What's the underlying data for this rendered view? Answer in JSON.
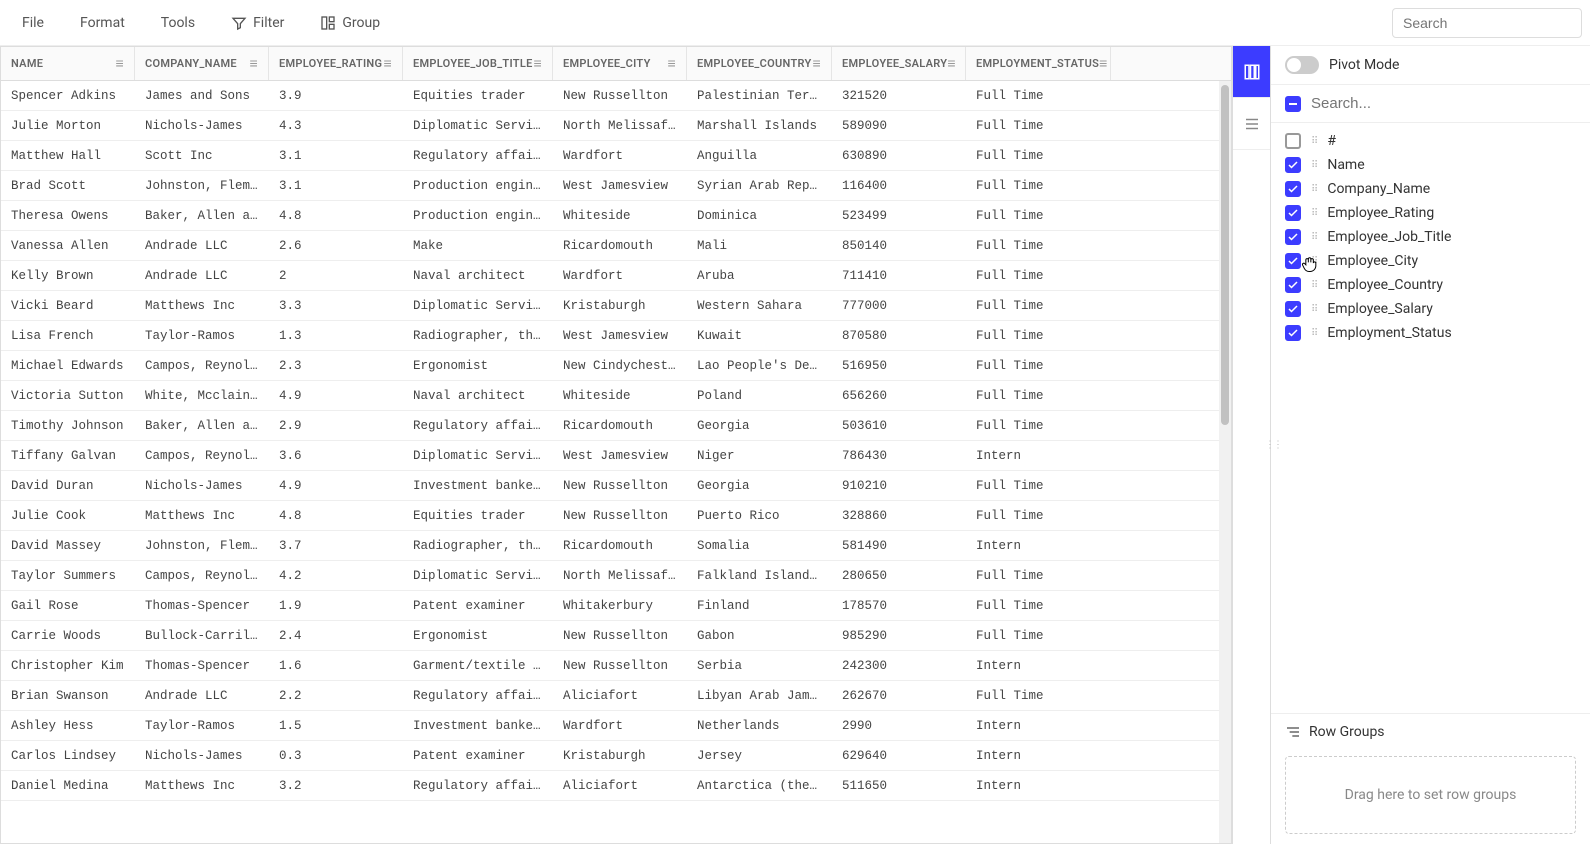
{
  "toolbar": {
    "file": "File",
    "format": "Format",
    "tools": "Tools",
    "filter": "Filter",
    "group": "Group",
    "search_placeholder": "Search"
  },
  "columns": [
    "NAME",
    "COMPANY_NAME",
    "EMPLOYEE_RATING",
    "EMPLOYEE_JOB_TITLE",
    "EMPLOYEE_CITY",
    "EMPLOYEE_COUNTRY",
    "EMPLOYEE_SALARY",
    "EMPLOYMENT_STATUS"
  ],
  "rows": [
    [
      "Spencer Adkins",
      "James and Sons",
      "3.9",
      "Equities trader",
      "New Russellton",
      "Palestinian Territory",
      "321520",
      "Full Time"
    ],
    [
      "Julie Morton",
      "Nichols-James",
      "4.3",
      "Diplomatic Services op",
      "North Melissafurt",
      "Marshall Islands",
      "589090",
      "Full Time"
    ],
    [
      "Matthew Hall",
      "Scott Inc",
      "3.1",
      "Regulatory affairs offi",
      "Wardfort",
      "Anguilla",
      "630890",
      "Full Time"
    ],
    [
      "Brad Scott",
      "Johnston, Fleming a",
      "3.1",
      "Production engineer",
      "West Jamesview",
      "Syrian Arab Republic",
      "116400",
      "Full Time"
    ],
    [
      "Theresa Owens",
      "Baker, Allen and Ed",
      "4.8",
      "Production engineer",
      "Whiteside",
      "Dominica",
      "523499",
      "Full Time"
    ],
    [
      "Vanessa Allen",
      "Andrade LLC",
      "2.6",
      "Make",
      "Ricardomouth",
      "Mali",
      "850140",
      "Full Time"
    ],
    [
      "Kelly Brown",
      "Andrade LLC",
      "2",
      "Naval architect",
      "Wardfort",
      "Aruba",
      "711410",
      "Full Time"
    ],
    [
      "Vicki Beard",
      "Matthews Inc",
      "3.3",
      "Diplomatic Services op",
      "Kristaburgh",
      "Western Sahara",
      "777000",
      "Full Time"
    ],
    [
      "Lisa French",
      "Taylor-Ramos",
      "1.3",
      "Radiographer, therapeu",
      "West Jamesview",
      "Kuwait",
      "870580",
      "Full Time"
    ],
    [
      "Michael Edwards",
      "Campos, Reynolds an",
      "2.3",
      "Ergonomist",
      "New Cindychester",
      "Lao People's Democrat",
      "516950",
      "Full Time"
    ],
    [
      "Victoria Sutton",
      "White, Mcclain and",
      "4.9",
      "Naval architect",
      "Whiteside",
      "Poland",
      "656260",
      "Full Time"
    ],
    [
      "Timothy Johnson",
      "Baker, Allen and Ed",
      "2.9",
      "Regulatory affairs offi",
      "Ricardomouth",
      "Georgia",
      "503610",
      "Full Time"
    ],
    [
      "Tiffany Galvan",
      "Campos, Reynolds an",
      "3.6",
      "Diplomatic Services op",
      "West Jamesview",
      "Niger",
      "786430",
      "Intern"
    ],
    [
      "David Duran",
      "Nichols-James",
      "4.9",
      "Investment banker, cor",
      "New Russellton",
      "Georgia",
      "910210",
      "Full Time"
    ],
    [
      "Julie Cook",
      "Matthews Inc",
      "4.8",
      "Equities trader",
      "New Russellton",
      "Puerto Rico",
      "328860",
      "Full Time"
    ],
    [
      "David Massey",
      "Johnston, Fleming a",
      "3.7",
      "Radiographer, therapeu",
      "Ricardomouth",
      "Somalia",
      "581490",
      "Intern"
    ],
    [
      "Taylor Summers",
      "Campos, Reynolds an",
      "4.2",
      "Diplomatic Services op",
      "North Melissafurt",
      "Falkland Islands (Mal",
      "280650",
      "Full Time"
    ],
    [
      "Gail Rose",
      "Thomas-Spencer",
      "1.9",
      "Patent examiner",
      "Whitakerbury",
      "Finland",
      "178570",
      "Full Time"
    ],
    [
      "Carrie Woods",
      "Bullock-Carrillo",
      "2.4",
      "Ergonomist",
      "New Russellton",
      "Gabon",
      "985290",
      "Full Time"
    ],
    [
      "Christopher Kim",
      "Thomas-Spencer",
      "1.6",
      "Garment/textile technc",
      "New Russellton",
      "Serbia",
      "242300",
      "Intern"
    ],
    [
      "Brian Swanson",
      "Andrade LLC",
      "2.2",
      "Regulatory affairs offi",
      "Aliciafort",
      "Libyan Arab Jamahiriy",
      "262670",
      "Full Time"
    ],
    [
      "Ashley Hess",
      "Taylor-Ramos",
      "1.5",
      "Investment banker, cor",
      "Wardfort",
      "Netherlands",
      "2990",
      "Intern"
    ],
    [
      "Carlos Lindsey",
      "Nichols-James",
      "0.3",
      "Patent examiner",
      "Kristaburgh",
      "Jersey",
      "629640",
      "Intern"
    ],
    [
      "Daniel Medina",
      "Matthews Inc",
      "3.2",
      "Regulatory affairs offi",
      "Aliciafort",
      "Antarctica (the terri",
      "511650",
      "Intern"
    ]
  ],
  "panel": {
    "pivot_mode": "Pivot Mode",
    "search_placeholder": "Search...",
    "fields": [
      {
        "label": "#",
        "checked": false
      },
      {
        "label": "Name",
        "checked": true
      },
      {
        "label": "Company_Name",
        "checked": true
      },
      {
        "label": "Employee_Rating",
        "checked": true
      },
      {
        "label": "Employee_Job_Title",
        "checked": true
      },
      {
        "label": "Employee_City",
        "checked": true
      },
      {
        "label": "Employee_Country",
        "checked": true
      },
      {
        "label": "Employee_Salary",
        "checked": true
      },
      {
        "label": "Employment_Status",
        "checked": true
      }
    ],
    "row_groups_title": "Row Groups",
    "row_groups_drop": "Drag here to set row groups"
  }
}
